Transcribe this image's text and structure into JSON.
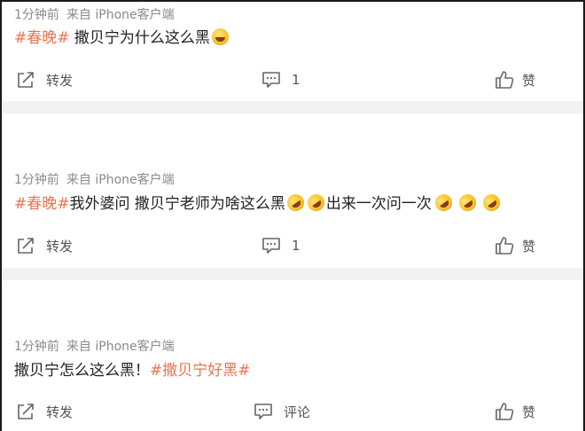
{
  "posts": [
    {
      "time": "1分钟前",
      "source": "来自 iPhone客户端",
      "content_tag": "#春晚#",
      "content_text": " 撒贝宁为什么这么黑",
      "emoji": [
        "laughing-tears-icon"
      ],
      "share_label": "转发",
      "comment_label": "1",
      "like_label": "赞"
    },
    {
      "time": "1分钟前",
      "source": "来自 iPhone客户端",
      "content_tag": "#春晚#",
      "content_text_1": "我外婆问 撒贝宁老师为啥这么黑",
      "content_text_2": "出来一次问一次",
      "emoji": [
        "rolling-laugh-icon",
        "rolling-laugh-icon",
        "rolling-laugh-icon",
        "rolling-laugh-icon",
        "rolling-laugh-icon"
      ],
      "share_label": "转发",
      "comment_label": "1",
      "like_label": "赞"
    },
    {
      "time": "1分钟前",
      "source": "来自 iPhone客户端",
      "content_text": "撒贝宁怎么这么黑！",
      "content_tag": "#撒贝宁好黑#",
      "share_label": "转发",
      "comment_label": "评论",
      "like_label": "赞"
    }
  ],
  "colors": {
    "tag": "#eb7350",
    "meta": "#8a8a8a",
    "separator": "#f2f2f2",
    "text": "#222222"
  }
}
